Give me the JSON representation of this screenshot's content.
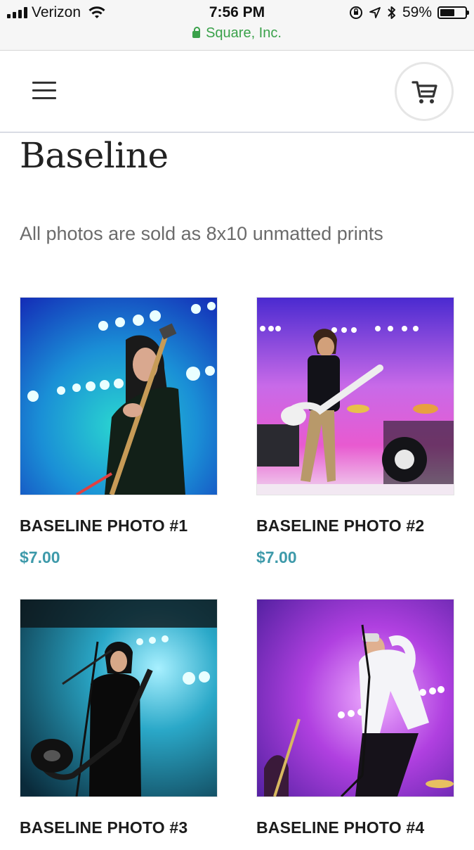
{
  "status_bar": {
    "carrier": "Verizon",
    "time": "7:56 PM",
    "battery_percent": "59%",
    "battery_level": 0.59
  },
  "url_bar": {
    "site_label": "Square, Inc."
  },
  "header": {
    "menu_icon": "hamburger-menu-icon",
    "cart_icon": "shopping-cart-icon"
  },
  "page": {
    "title": "Baseline",
    "description": "All photos are sold as 8x10 unmatted prints"
  },
  "products": [
    {
      "name": "BASELINE PHOTO #1",
      "price": "$7.00"
    },
    {
      "name": "BASELINE PHOTO #2",
      "price": "$7.00"
    },
    {
      "name": "BASELINE PHOTO #3",
      "price": ""
    },
    {
      "name": "BASELINE PHOTO #4",
      "price": ""
    }
  ],
  "colors": {
    "price": "#3e9aaa",
    "secure_green": "#3aa14a"
  }
}
